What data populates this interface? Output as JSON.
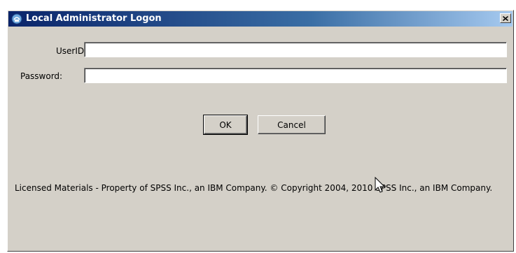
{
  "window": {
    "title": "Local Administrator Logon",
    "title_icon": "app-icon",
    "close_icon": "close-icon"
  },
  "form": {
    "userid_label": "UserID:",
    "userid_value": "",
    "password_label": "Password:",
    "password_value": ""
  },
  "buttons": {
    "ok_label": "OK",
    "cancel_label": "Cancel"
  },
  "legal_text": "Licensed Materials - Property of SPSS Inc., an IBM Company. © Copyright 2004, 2010 SPSS Inc., an IBM Company.",
  "colors": {
    "dialog_bg": "#d4d0c8",
    "titlebar_start": "#0a246a",
    "titlebar_end": "#a6caf0"
  }
}
